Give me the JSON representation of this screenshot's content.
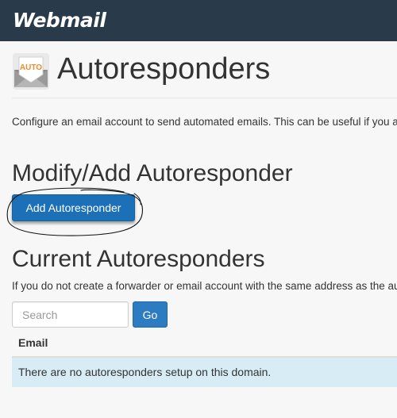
{
  "header": {
    "brand": "Webmail"
  },
  "page": {
    "icon_label": "AUTO",
    "title": "Autoresponders",
    "description": "Configure an email account to send automated emails. This can be useful if you are on vacation or unavailable, or if you have a generic message that you wish to send from a support email address."
  },
  "modify_section": {
    "heading": "Modify/Add Autoresponder",
    "add_button_label": "Add Autoresponder"
  },
  "current_section": {
    "heading": "Current Autoresponders",
    "help_text": "If you do not create a forwarder or email account with the same address as the autoresponder, the autoresponder will only send a reply.",
    "search_placeholder": "Search",
    "search_value": "",
    "go_button_label": "Go",
    "table": {
      "columns": [
        "Email"
      ],
      "empty_message": "There are no autoresponders setup on this domain."
    }
  },
  "colors": {
    "topbar": "#293a4a",
    "primary_button": "#1b70b8",
    "empty_row": "#d8ecf6",
    "icon_accent": "#f08a2c"
  },
  "icons": {
    "page_icon": "envelope-auto-icon"
  }
}
